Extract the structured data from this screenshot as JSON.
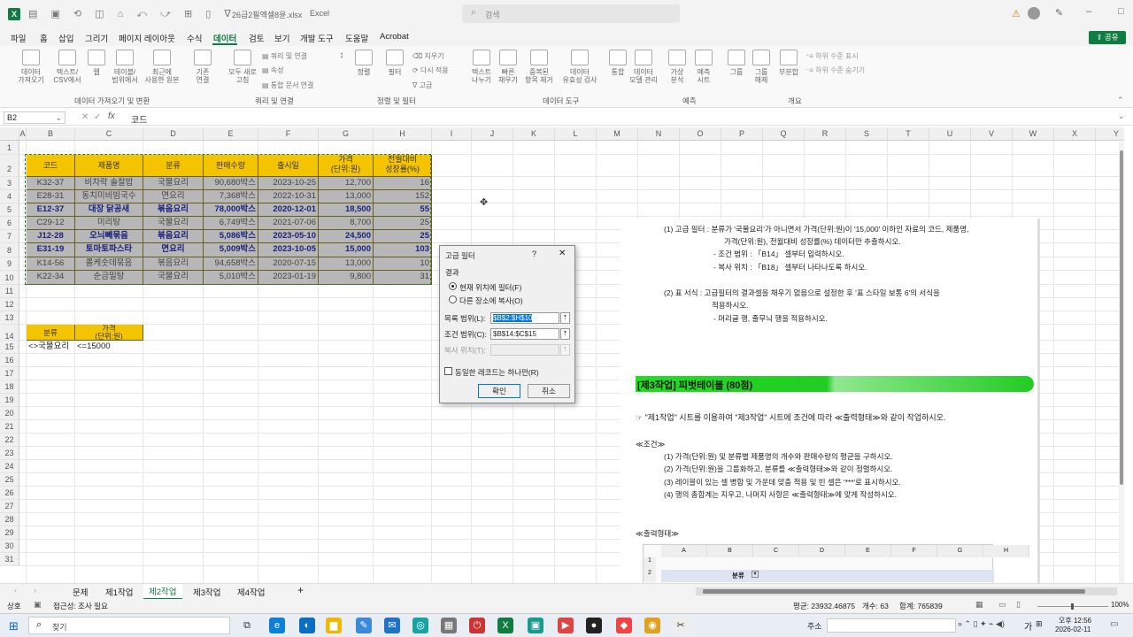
{
  "title": {
    "filename": "26급2필엑셀8윤.xlsx",
    "app": "Excel",
    "search": "검색"
  },
  "menu": [
    "파일",
    "홈",
    "삽입",
    "그리기",
    "페이지 레이아웃",
    "수식",
    "데이터",
    "검토",
    "보기",
    "개발 도구",
    "도움말",
    "Acrobat"
  ],
  "share_label": "공유",
  "ribbon": {
    "buttons": [
      "데이터\n가져오기",
      "텍스트/\nCSV에서",
      "웹",
      "테이블/\n범위에서",
      "최근에\n사용한 원본",
      "기존\n연결",
      "모두 새로\n고침",
      "정렬",
      "필터",
      "텍스트\n나누기",
      "빠른\n채우기",
      "중복된\n항목 제거",
      "데이터\n유효성 검사",
      "통합",
      "데이터\n모델 관리",
      "가상\n분석",
      "예측\n시트",
      "그룹",
      "그룹\n해제",
      "부분합"
    ],
    "small": [
      "쿼리 및 연결",
      "속성",
      "통합 문서 연결",
      "지우기",
      "다시 적용",
      "고급",
      "하위 수준 표시",
      "하위 수준 숨기기"
    ],
    "groups": [
      "데이터 가져오기 및 변환",
      "쿼리 및 연결",
      "정렬 및 필터",
      "데이터 도구",
      "예측",
      "개요"
    ]
  },
  "formula": {
    "namebox": "B2",
    "fx": "fx",
    "content": "코드"
  },
  "columns": [
    "A",
    "B",
    "C",
    "D",
    "E",
    "F",
    "G",
    "H",
    "I",
    "J",
    "K",
    "L",
    "M",
    "N",
    "O",
    "P",
    "Q",
    "R",
    "S",
    "T",
    "U",
    "V",
    "W",
    "X",
    "Y"
  ],
  "rows": [
    "1",
    "2",
    "3",
    "4",
    "5",
    "6",
    "7",
    "8",
    "9",
    "10",
    "11",
    "12",
    "13",
    "14",
    "15",
    "16",
    "17",
    "18",
    "19",
    "20",
    "21",
    "22",
    "23",
    "24",
    "25",
    "26",
    "27",
    "28",
    "29",
    "30",
    "31"
  ],
  "table": {
    "headers": [
      "코드",
      "제품명",
      "분류",
      "판매수량",
      "출시일",
      "가격\n(단위:원)",
      "전월대비\n성장률(%)"
    ],
    "rows": [
      [
        "K32-37",
        "비차락 솔찰밥",
        "국물요리",
        "90,680박스",
        "2023-10-25",
        "12,700",
        "16"
      ],
      [
        "E28-31",
        "동치미비빔국수",
        "면요리",
        "7,368박스",
        "2022-10-31",
        "13,000",
        "152"
      ],
      [
        "E12-37",
        "대장 닭공새",
        "볶음요리",
        "78,000박스",
        "2020-12-01",
        "18,500",
        "55"
      ],
      [
        "C29-12",
        "미리탕",
        "국물요리",
        "6,749박스",
        "2021-07-06",
        "8,700",
        "25"
      ],
      [
        "J12-28",
        "오늬빼묶음",
        "볶음요리",
        "5,086박스",
        "2023-05-10",
        "24,500",
        "25"
      ],
      [
        "E31-19",
        "토마토파스타",
        "면요리",
        "5,009박스",
        "2023-10-05",
        "15,000",
        "103"
      ],
      [
        "K14-56",
        "롤케숫데묶음",
        "볶음요리",
        "94,658박스",
        "2020-07-15",
        "13,000",
        "10"
      ],
      [
        "K22-34",
        "순금밀탕",
        "국물요리",
        "5,010박스",
        "2023-01-19",
        "9,800",
        "31"
      ]
    ]
  },
  "criteria": {
    "headers": [
      "분류",
      "가격\n(단위:원)"
    ],
    "values": [
      "<>국물요리",
      "<=15000"
    ]
  },
  "dialog": {
    "title": "고급 필터",
    "help": "?",
    "close": "✕",
    "section": "결과",
    "radio1": "현재 위치에 필터(F)",
    "radio2": "다른 장소에 복사(O)",
    "list_label": "목록 범위(L):",
    "list_value": "$B$2:$H$10",
    "criteria_label": "조건 범위(C):",
    "criteria_value": "$B$14:$C$15",
    "copy_label": "복사 위치(T):",
    "copy_value": "",
    "unique": "동일한 레코드는 하나만(R)",
    "ok": "확인",
    "cancel": "취소"
  },
  "doc": {
    "lines": [
      "(1) 고급 필터 : 분류가 '국물요리'가 아니면서 가격(단위:원)이 '15,000' 이하인 자료의 코드, 제품명,",
      "가격(단위:원), 전월대비 성장률(%) 데이터만 추출하시오.",
      "- 조건 범위 : 「B14」 셀부터 입력하시오.",
      "- 복사 위치 : 「B18」 셀부터 나타나도록 하시오.",
      "(2) 표 서식 : 고급필터의 결과셀을 채우기 없음으로 설정한 후 '표 스타일 보통 6'의 서식을",
      "적용하시오.",
      "- 머리글 행, 줄무늬 행을 적용하시오."
    ],
    "section_title": "[제3작업] 피벗테이블 (80점)",
    "intro": "☞ \"제1작업\" 시트를 이용하여 \"제3작업\" 시트에 조건에 따라 ≪출력형태≫와 같이 작업하시오.",
    "cond_title": "≪조건≫",
    "conds": [
      "(1) 가격(단위:원) 및 분류별 제품명의 개수와 판매수량의 평균을 구하시오.",
      "(2) 가격(단위:원)을 그룹화하고, 분류를 ≪출력형태≫와 같이 정렬하시오.",
      "(3) 레이블이 있는 셀 병합 및 가운데 맞춤 적용 및 빈 셀은 '***'로 표시하시오.",
      "(4) 행의 총합계는 지우고, 나머지 사항은 ≪출력형태≫에 맞게 작성하시오."
    ],
    "output_title": "≪출력형태≫",
    "mini_cols": [
      "A",
      "B",
      "C",
      "D",
      "E",
      "F",
      "G",
      "H"
    ],
    "mini_rows": [
      "1",
      "2"
    ],
    "mini_cell": "분류"
  },
  "sheets": [
    "문제",
    "제1작업",
    "제2작업",
    "제3작업",
    "제4작업"
  ],
  "active_sheet": "제2작업",
  "status": {
    "ready": "상호",
    "accessibility": "접근성: 조사 필요",
    "avg": "평균: 23932.46875",
    "count": "개수: 63",
    "sum": "합계: 765839",
    "zoom": "100%"
  },
  "taskbar": {
    "search": "찾기",
    "address": "주소",
    "time": "오후 12:56",
    "date": "2026-02-11",
    "lang": "가"
  },
  "colors": {
    "accent": "#107c41",
    "header_fill": "#f5c400",
    "table_fill": "#b7b7b7",
    "green_banner": "#22cc22"
  }
}
